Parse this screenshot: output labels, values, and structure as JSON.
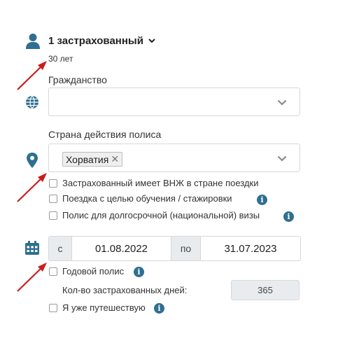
{
  "insured": {
    "title": "1 застрахованный",
    "age": "30 лет"
  },
  "citizenship": {
    "label": "Гражданство",
    "value": ""
  },
  "policy_country": {
    "label": "Страна действия полиса",
    "selected_tag": "Хорватия",
    "remove_symbol": "✕"
  },
  "options": {
    "residence_permit": "Застрахованный имеет ВНЖ в стране поездки",
    "study_trip": "Поездка с целью обучения / стажировки",
    "long_term_visa": "Полис для долгосрочной (национальной) визы"
  },
  "dates": {
    "from_prefix": "с",
    "from_value": "01.08.2022",
    "to_prefix": "по",
    "to_value": "31.07.2023"
  },
  "annual": {
    "label": "Годовой полис",
    "days_label": "Кол-во застрахованных дней:",
    "days_value": "365"
  },
  "already_traveling": "Я уже путешествую",
  "info_symbol": "i",
  "colors": {
    "accent": "#2f6f8f",
    "arrow": "#c81e1e",
    "border": "#d7d7d7",
    "readonly_bg": "#e9ecef"
  },
  "icons": [
    "person-icon",
    "globe-icon",
    "map-pin-icon",
    "calendar-icon",
    "chevron-down-icon",
    "info-icon"
  ]
}
